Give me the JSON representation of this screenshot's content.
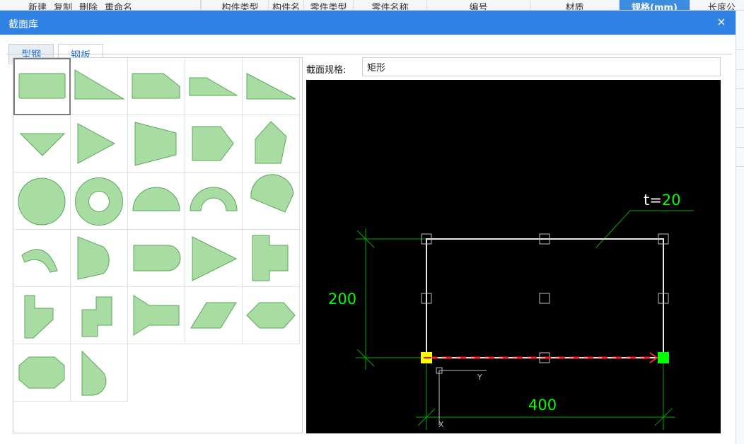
{
  "background": {
    "toolbar": [
      "新建",
      "复制",
      "删除",
      "重命名"
    ],
    "columns": [
      {
        "label": "构件类型",
        "width": 80,
        "active": false
      },
      {
        "label": "构件名",
        "width": 50,
        "active": false
      },
      {
        "label": "零件类型",
        "width": 70,
        "active": false
      },
      {
        "label": "零件名称",
        "width": 104,
        "active": false
      },
      {
        "label": "编号",
        "width": 146,
        "active": false
      },
      {
        "label": "材质",
        "width": 126,
        "active": false
      },
      {
        "label": "规格(mm)",
        "width": 100,
        "active": true
      },
      {
        "label": "长度公",
        "width": 90,
        "active": false
      }
    ]
  },
  "dialog": {
    "title": "截面库",
    "close_label": "×"
  },
  "tabs": [
    {
      "label": "型钢",
      "active": false
    },
    {
      "label": "钢板",
      "active": true
    }
  ],
  "spec": {
    "label": "截面规格:",
    "value": "矩形"
  },
  "drawing": {
    "thickness_prefix": "t=",
    "thickness_value": "20",
    "height_value": "200",
    "width_value": "400",
    "axis_y_label": "Y",
    "axis_x_label": "X"
  },
  "shapes": [
    "rectangle",
    "right-triangle",
    "chamfered-rectangle",
    "trapezoid-ramp",
    "thin-triangle",
    "inverted-triangle",
    "triangle-right",
    "trapezoid-right",
    "pointed-rectangle",
    "irregular-pentagon",
    "circle",
    "ring",
    "semicircle",
    "half-ring",
    "circular-sector",
    "arc-segment",
    "half-round-triangle",
    "stadium",
    "isoceles-triangle",
    "t-shape",
    "l-chamfer-shape",
    "z-shape",
    "tapered-bar",
    "parallelogram",
    "hexagon",
    "octagon",
    "rounded-triangle"
  ],
  "colors": {
    "titlebar": "#2f82e3",
    "shape_fill": "#a8dca3",
    "shape_stroke": "#5aa85a",
    "dim_green": "#00ff00",
    "canvas_bg": "#000000"
  }
}
